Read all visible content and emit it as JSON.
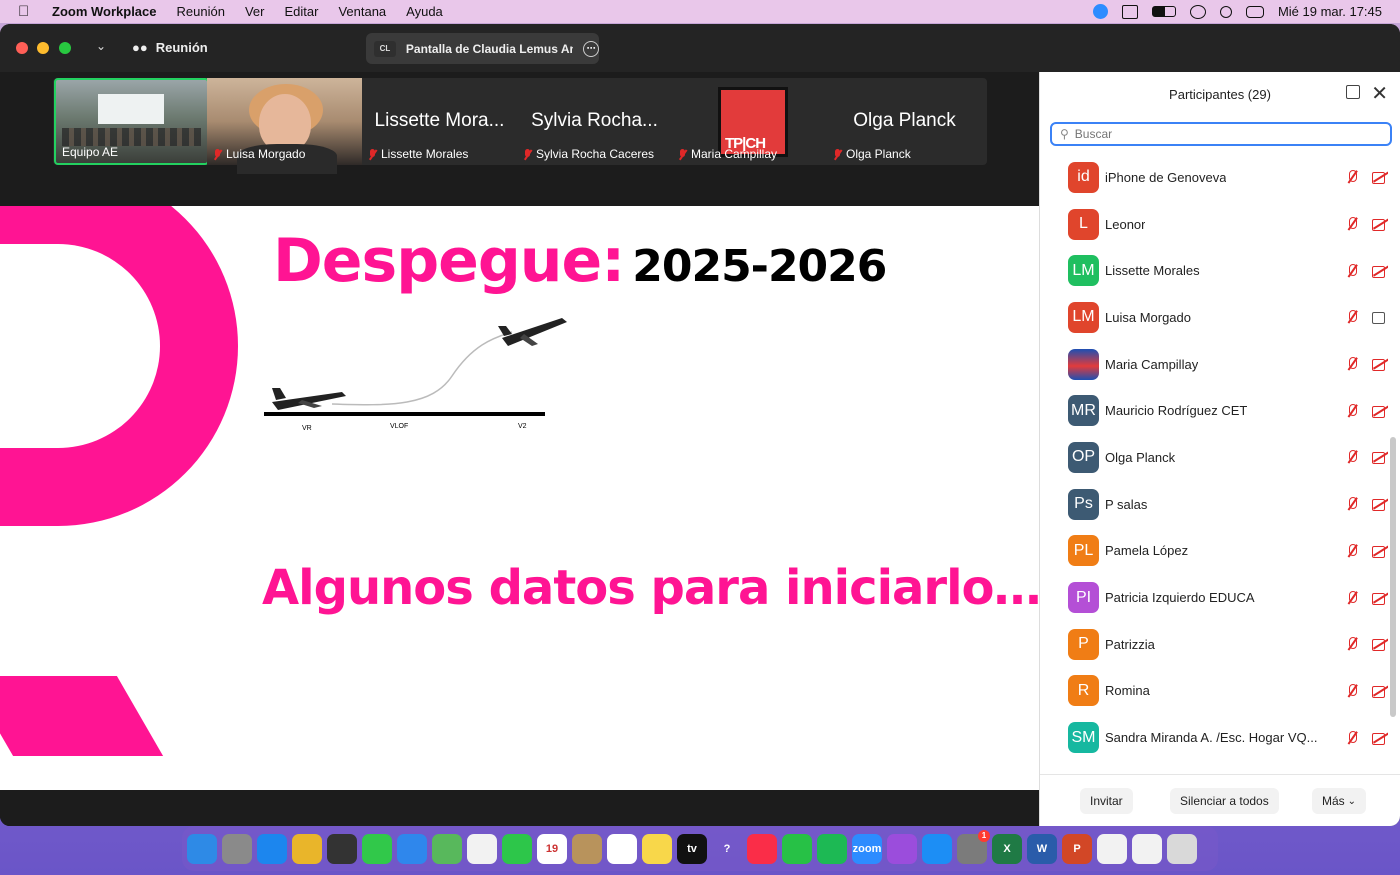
{
  "menubar": {
    "app_name": "Zoom Workplace",
    "menus": [
      "Reunión",
      "Ver",
      "Editar",
      "Ventana",
      "Ayuda"
    ],
    "clock": "Mié 19 mar.  17:45"
  },
  "window": {
    "meeting_label": "Reunión",
    "share_initials": "CL",
    "share_title": "Pantalla de Claudia Lemus An"
  },
  "gallery": {
    "tiles": [
      {
        "caption": "Equipo AE",
        "large_name": ""
      },
      {
        "caption": "Luisa Morgado",
        "large_name": ""
      },
      {
        "caption": "Lissette Morales",
        "large_name": "Lissette Mora..."
      },
      {
        "caption": "Sylvia Rocha Caceres",
        "large_name": "Sylvia Rocha..."
      },
      {
        "caption": "Maria Campillay",
        "large_name": ""
      },
      {
        "caption": "Olga Planck",
        "large_name": "Olga Planck"
      }
    ]
  },
  "slide": {
    "title": "Despegue:",
    "year": "2025-2026",
    "subtitle": "Algunos datos para iniciarlo…",
    "diagram_labels": [
      "VR",
      "VLOF",
      "V2"
    ]
  },
  "participants": {
    "header": "Participantes (29)",
    "search_placeholder": "Buscar",
    "list": [
      {
        "initials": "id",
        "name": "iPhone de Genoveva",
        "color": "#e0452c",
        "video": false
      },
      {
        "initials": "L",
        "name": "Leonor",
        "color": "#e0452c",
        "video": false
      },
      {
        "initials": "LM",
        "name": "Lissette Morales",
        "color": "#1fbf60",
        "video": false
      },
      {
        "initials": "LM",
        "name": "Luisa Morgado",
        "color": "#e0452c",
        "video": true
      },
      {
        "initials": "",
        "name": "Maria Campillay",
        "color": "#1d4fb3",
        "video": false,
        "image": true
      },
      {
        "initials": "MR",
        "name": "Mauricio Rodríguez CET",
        "color": "#3d5a73",
        "video": false
      },
      {
        "initials": "OP",
        "name": "Olga Planck",
        "color": "#3d5a73",
        "video": false
      },
      {
        "initials": "Ps",
        "name": "P salas",
        "color": "#3d5a73",
        "video": false
      },
      {
        "initials": "PL",
        "name": "Pamela López",
        "color": "#f07d15",
        "video": false
      },
      {
        "initials": "PI",
        "name": "Patricia Izquierdo EDUCA",
        "color": "#b44fd6",
        "video": false
      },
      {
        "initials": "P",
        "name": "Patrizzia",
        "color": "#f07d15",
        "video": false
      },
      {
        "initials": "R",
        "name": "Romina",
        "color": "#f07d15",
        "video": false
      },
      {
        "initials": "SM",
        "name": "Sandra Miranda A. /Esc. Hogar VQ...",
        "color": "#16b8a0",
        "video": false
      }
    ],
    "footer": {
      "invite": "Invitar",
      "mute_all": "Silenciar a todos",
      "more": "Más"
    }
  },
  "dock": {
    "icons": [
      {
        "name": "finder",
        "color": "#2e8ae6",
        "glyph": ""
      },
      {
        "name": "launchpad",
        "color": "#8a8a8a",
        "glyph": ""
      },
      {
        "name": "safari",
        "color": "#1c86ee",
        "glyph": ""
      },
      {
        "name": "chrome",
        "color": "#e9b52a",
        "glyph": ""
      },
      {
        "name": "notchmeister",
        "color": "#333",
        "glyph": ""
      },
      {
        "name": "messages",
        "color": "#31c84a",
        "glyph": ""
      },
      {
        "name": "mail",
        "color": "#2f87ec",
        "glyph": ""
      },
      {
        "name": "maps",
        "color": "#58b85c",
        "glyph": ""
      },
      {
        "name": "photos",
        "color": "#f2f2f2",
        "glyph": ""
      },
      {
        "name": "facetime",
        "color": "#2dc64a",
        "glyph": ""
      },
      {
        "name": "calendar",
        "color": "#ffffff",
        "glyph": "19"
      },
      {
        "name": "contacts",
        "color": "#b8935c",
        "glyph": ""
      },
      {
        "name": "reminders",
        "color": "#ffffff",
        "glyph": ""
      },
      {
        "name": "notes",
        "color": "#f8d74a",
        "glyph": ""
      },
      {
        "name": "apple-tv",
        "color": "#111111",
        "glyph": "tv"
      },
      {
        "name": "help",
        "color": "transparent",
        "glyph": "?"
      },
      {
        "name": "music",
        "color": "#fa2d48",
        "glyph": ""
      },
      {
        "name": "whatsapp",
        "color": "#27c146",
        "glyph": ""
      },
      {
        "name": "spotify",
        "color": "#1db954",
        "glyph": ""
      },
      {
        "name": "zoom",
        "color": "#2d8cff",
        "glyph": "zoom"
      },
      {
        "name": "podcasts",
        "color": "#9b4ddc",
        "glyph": ""
      },
      {
        "name": "app-store",
        "color": "#1c8ef5",
        "glyph": ""
      },
      {
        "name": "system-settings",
        "color": "#7b7b7b",
        "glyph": "",
        "badge": "1"
      },
      {
        "name": "excel",
        "color": "#1f7a45",
        "glyph": "X"
      },
      {
        "name": "word",
        "color": "#2a5caa",
        "glyph": "W"
      },
      {
        "name": "powerpoint",
        "color": "#d24726",
        "glyph": "P"
      },
      {
        "name": "documents",
        "color": "#f2f2f2",
        "glyph": ""
      },
      {
        "name": "pdf-file",
        "color": "#f2f2f2",
        "glyph": ""
      },
      {
        "name": "trash",
        "color": "#d9d9d9",
        "glyph": ""
      }
    ]
  }
}
